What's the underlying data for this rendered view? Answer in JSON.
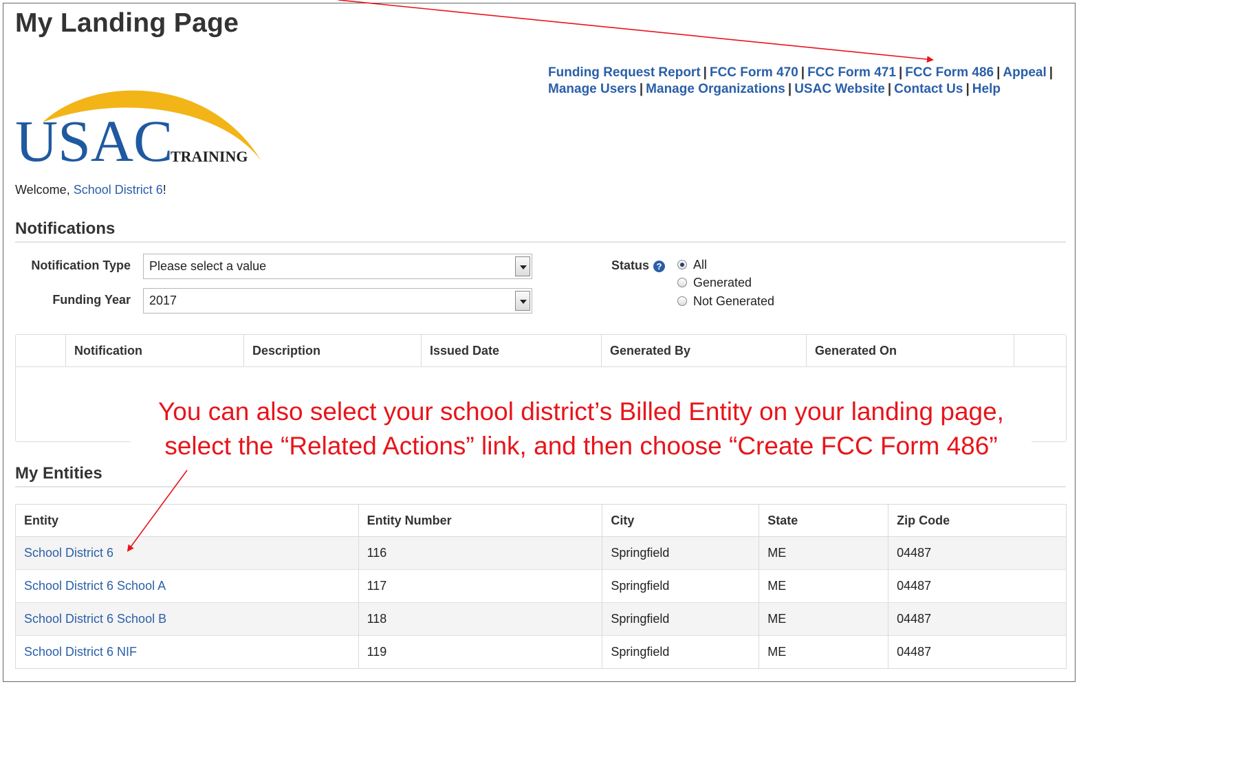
{
  "page": {
    "title": "My Landing Page"
  },
  "top_links": [
    {
      "label": "Funding Request Report"
    },
    {
      "label": "FCC Form 470"
    },
    {
      "label": "FCC Form 471"
    },
    {
      "label": "FCC Form 486"
    },
    {
      "label": "Appeal"
    },
    {
      "label": "Manage Users"
    },
    {
      "label": "Manage Organizations"
    },
    {
      "label": "USAC Website"
    },
    {
      "label": "Contact Us"
    },
    {
      "label": "Help"
    }
  ],
  "logo": {
    "main_text": "USAC",
    "sub_text": "TRAINING"
  },
  "welcome": {
    "prefix": "Welcome, ",
    "user": "School District 6",
    "suffix": "!"
  },
  "notifications": {
    "title": "Notifications",
    "type_label": "Notification Type",
    "type_value": "Please select a value",
    "year_label": "Funding Year",
    "year_value": "2017",
    "status_label": "Status",
    "status_options": [
      {
        "label": "All",
        "selected": true
      },
      {
        "label": "Generated",
        "selected": false
      },
      {
        "label": "Not Generated",
        "selected": false
      }
    ],
    "columns": [
      "Notification",
      "Description",
      "Issued Date",
      "Generated By",
      "Generated On"
    ]
  },
  "callout": {
    "line1": "You can also select your school district’s Billed Entity on your landing page,",
    "line2": "select the “Related Actions” link, and then choose “Create FCC Form 486”"
  },
  "entities": {
    "title": "My Entities",
    "columns": [
      "Entity",
      "Entity Number",
      "City",
      "State",
      "Zip Code"
    ],
    "rows": [
      {
        "entity": "School District 6",
        "number": "116",
        "city": "Springfield",
        "state": "ME",
        "zip": "04487"
      },
      {
        "entity": "School District 6 School A",
        "number": "117",
        "city": "Springfield",
        "state": "ME",
        "zip": "04487"
      },
      {
        "entity": "School District 6 School B",
        "number": "118",
        "city": "Springfield",
        "state": "ME",
        "zip": "04487"
      },
      {
        "entity": "School District 6 NIF",
        "number": "119",
        "city": "Springfield",
        "state": "ME",
        "zip": "04487"
      }
    ]
  },
  "colors": {
    "link": "#2a5fa8",
    "annotation": "#e8141a",
    "logo_blue": "#1f5aa0",
    "logo_gold": "#f2b417"
  },
  "icons": {
    "help": "question-circle-icon",
    "dropdown": "chevron-down-icon",
    "annotation": "arrow-icon"
  }
}
